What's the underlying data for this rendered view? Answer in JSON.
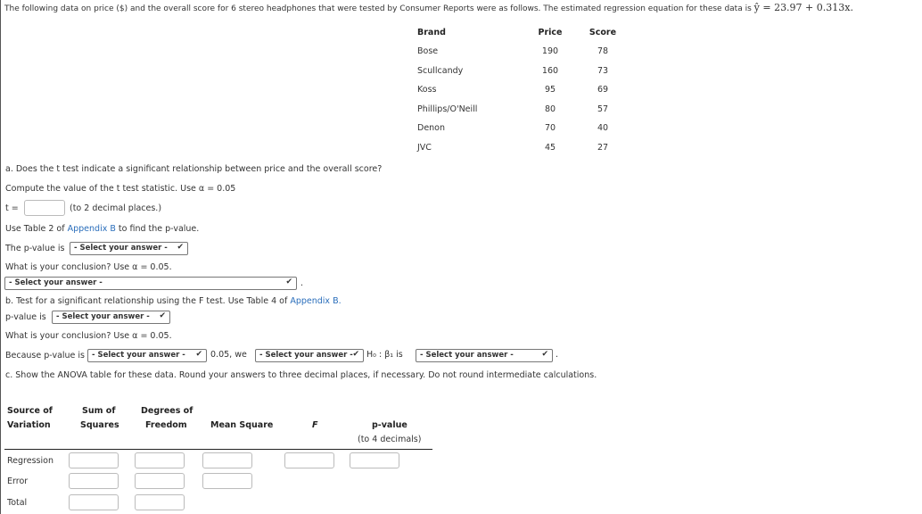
{
  "intro": {
    "text": "The following data on price ($) and the overall score for 6 stereo headphones that were tested by Consumer Reports were as follows. The estimated regression equation for these data is",
    "equation": "ŷ = 23.97 + 0.313x."
  },
  "data_table": {
    "headers": [
      "Brand",
      "Price",
      "Score"
    ],
    "rows": [
      [
        "Bose",
        "190",
        "78"
      ],
      [
        "Scullcandy",
        "160",
        "73"
      ],
      [
        "Koss",
        "95",
        "69"
      ],
      [
        "Phillips/O'Neill",
        "80",
        "57"
      ],
      [
        "Denon",
        "70",
        "40"
      ],
      [
        "JVC",
        "45",
        "27"
      ]
    ]
  },
  "part_a": {
    "question": "a. Does the t test indicate a significant relationship between price and the overall score?",
    "compute": "Compute the value of the t test statistic. Use α = 0.05",
    "t_label": "t =",
    "t_value": "",
    "t_hint": "(to 2 decimal places.)",
    "use_table_pre": "Use Table 2 of",
    "appendix": "Appendix B",
    "use_table_post": "to find the p-value.",
    "pvalue_label": "The p-value is",
    "select": "- Select your answer -",
    "conclusion": "What is your conclusion? Use α = 0.05."
  },
  "part_b": {
    "question_pre": "b. Test for a significant relationship using the F test. Use Table 4 of",
    "appendix": "Appendix B.",
    "pvalue_label": "p-value is",
    "select": "- Select your answer -",
    "conclusion": "What is your conclusion? Use α = 0.05.",
    "because": "Because p-value is",
    "mid": "0.05, we",
    "h0": "H₀ : β₁ is"
  },
  "part_c": {
    "text": "c. Show the ANOVA table for these data. Round your answers to three decimal places, if necessary. Do not round intermediate calculations.",
    "headers": {
      "source": [
        "Source of",
        "Variation"
      ],
      "ss": [
        "Sum of",
        "Squares"
      ],
      "df": [
        "Degrees of",
        "Freedom"
      ],
      "ms": "Mean Square",
      "f": "F",
      "p": [
        "p-value",
        "(to 4 decimals)"
      ]
    },
    "rows": [
      "Regression",
      "Error",
      "Total"
    ]
  }
}
